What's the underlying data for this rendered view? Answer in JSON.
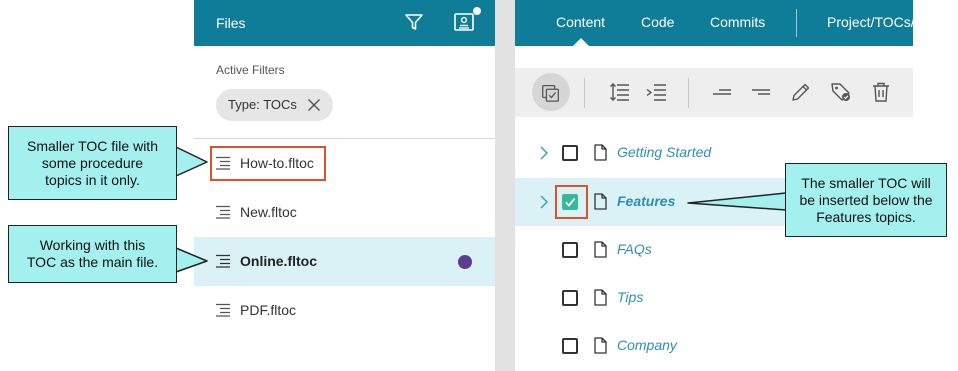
{
  "files_panel": {
    "title": "Files",
    "active_filters_label": "Active Filters",
    "filter_chip": {
      "key": "Type:",
      "value": "TOCs"
    },
    "files": [
      {
        "name": "How-to.fltoc",
        "selected": false
      },
      {
        "name": "New.fltoc",
        "selected": false
      },
      {
        "name": "Online.fltoc",
        "selected": true
      },
      {
        "name": "PDF.fltoc",
        "selected": false
      }
    ]
  },
  "content_panel": {
    "tabs": [
      {
        "label": "Content",
        "active": true
      },
      {
        "label": "Code",
        "active": false
      },
      {
        "label": "Commits",
        "active": false
      },
      {
        "label": "Project/TOCs/",
        "active": false
      }
    ],
    "toolbar_icons": [
      "select-all-icon",
      "indent-icon",
      "outdent-icon",
      "move-up-icon",
      "move-down-icon",
      "edit-icon",
      "tag-icon",
      "delete-icon"
    ],
    "toc_items": [
      {
        "label": "Getting Started",
        "expandable": true,
        "checked": false,
        "selected": false
      },
      {
        "label": "Features",
        "expandable": true,
        "checked": true,
        "selected": true
      },
      {
        "label": "FAQs",
        "expandable": false,
        "checked": false,
        "selected": false
      },
      {
        "label": "Tips",
        "expandable": false,
        "checked": false,
        "selected": false
      },
      {
        "label": "Company",
        "expandable": false,
        "checked": false,
        "selected": false
      }
    ]
  },
  "callouts": {
    "smaller_toc": [
      "Smaller TOC file with",
      "some procedure",
      "topics in it only."
    ],
    "main_file": [
      "Working with this",
      "TOC as the main file."
    ],
    "inserted": [
      "The smaller TOC will",
      "be inserted below the",
      "Features topics."
    ]
  },
  "colors": {
    "header": "#0f7c98",
    "selected_row": "#daf1f6",
    "callout_fill": "#a3f0ef",
    "highlight_border": "#d9542b",
    "checkbox_checked": "#3ab89c",
    "status_dot": "#5b3f8c",
    "link": "#2d8fb3"
  }
}
